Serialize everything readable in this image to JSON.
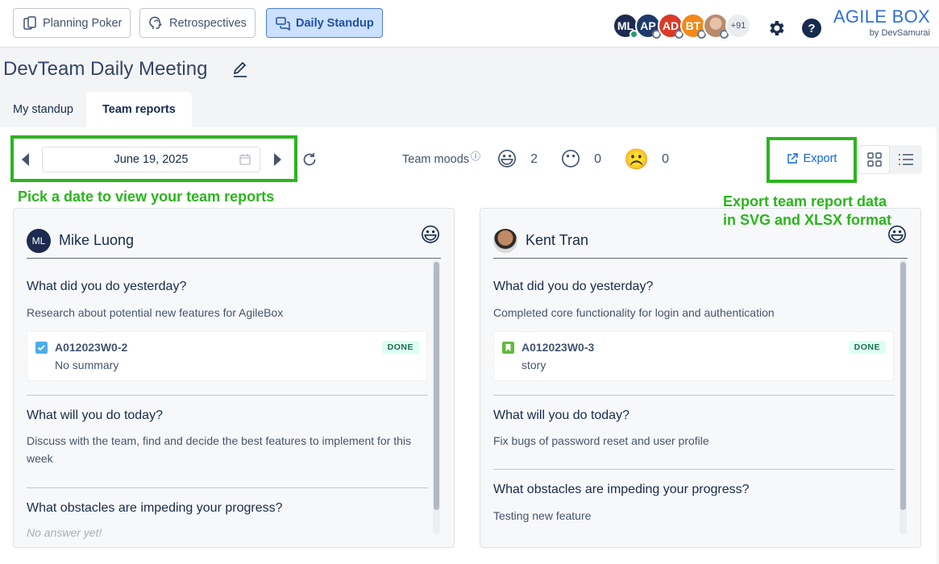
{
  "nav": {
    "planning_poker": "Planning Poker",
    "retrospectives": "Retrospectives",
    "daily_standup": "Daily Standup"
  },
  "avatars": [
    {
      "initials": "ML",
      "color": "#1d2b4f",
      "online": true
    },
    {
      "initials": "AP",
      "color": "#1d3a6b",
      "online": false
    },
    {
      "initials": "AD",
      "color": "#d93b28",
      "online": false
    },
    {
      "initials": "BT",
      "color": "#f18a1a",
      "online": false
    },
    {
      "initials": "",
      "color": "#c9a08a",
      "online": false
    }
  ],
  "avatars_more": "+91",
  "brand": {
    "title": "AGILE BOX",
    "subtitle": "by DevSamurai"
  },
  "page_title": "DevTeam Daily Meeting",
  "tabs": {
    "my_standup": "My standup",
    "team_reports": "Team reports"
  },
  "date": "June 19, 2025",
  "moods": {
    "label": "Team moods",
    "info_icon": "ⓘ",
    "happy_emoji": "😃",
    "happy_count": "2",
    "neutral_emoji": "😶",
    "neutral_count": "0",
    "sad_emoji": "☹️",
    "sad_count": "0"
  },
  "export_label": "Export",
  "annotations": {
    "date_hint": "Pick a date to view your team reports",
    "export_hint_1": "Export team report data",
    "export_hint_2": "in SVG and XLSX format"
  },
  "cards": [
    {
      "initials": "ML",
      "name": "Mike Luong",
      "mood": "😃",
      "q1": "What did you do yesterday?",
      "a1": "Research about potential new features for AgileBox",
      "issue_key": "A012023W0-2",
      "issue_summary": "No summary",
      "issue_status": "DONE",
      "q2": "What will you do today?",
      "a2": "Discuss with the team, find and decide the best features to implement for this week",
      "q3": "What obstacles are impeding your progress?",
      "a3": "No answer yet!"
    },
    {
      "name": "Kent Tran",
      "mood": "😃",
      "q1": "What did you do yesterday?",
      "a1": "Completed core functionality for login and authentication",
      "issue_key": "A012023W0-3",
      "issue_summary": "story",
      "issue_status": "DONE",
      "q2": "What will you do today?",
      "a2": "Fix bugs of password reset and user profile",
      "q3": "What obstacles are impeding your progress?",
      "a3": "Testing new feature"
    }
  ],
  "colors": {
    "accent": "#0c66e4",
    "annotation": "#2bb51e",
    "done_bg": "#dcfff1",
    "done_text": "#216e4e"
  }
}
